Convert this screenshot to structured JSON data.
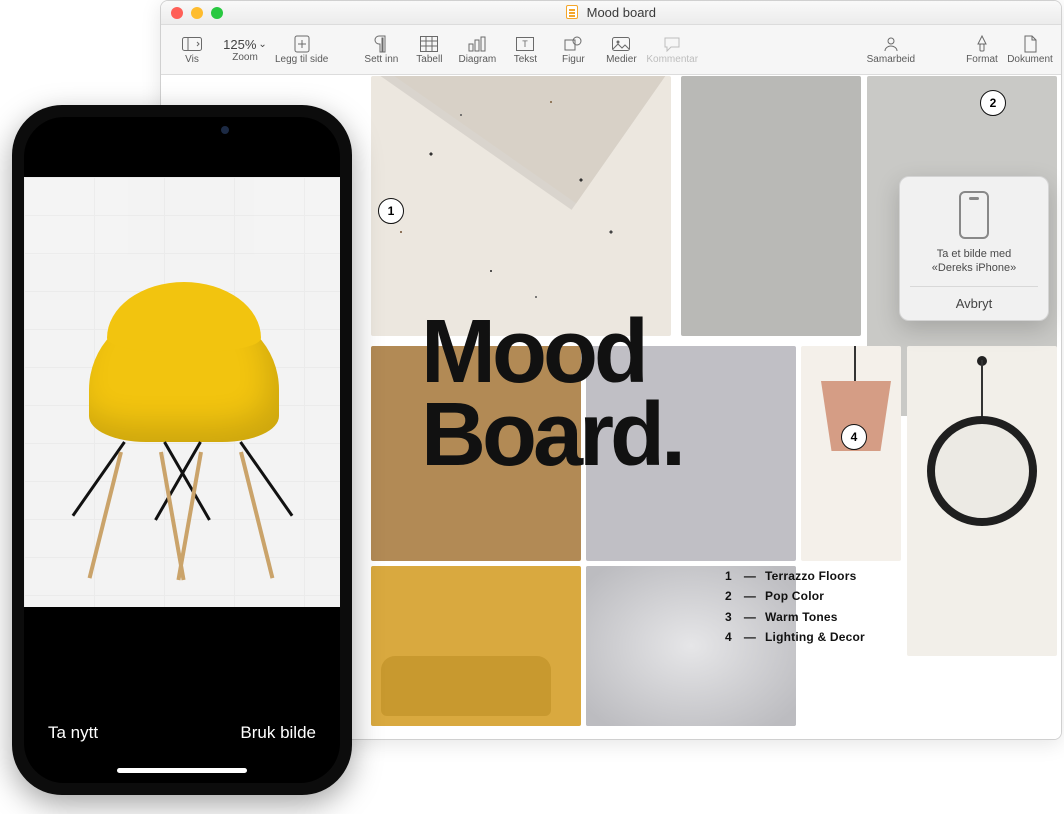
{
  "window": {
    "title": "Mood board"
  },
  "toolbar": {
    "vis": "Vis",
    "zoom_value": "125%",
    "zoom_label": "Zoom",
    "add_page": "Legg til side",
    "insert": "Sett inn",
    "table": "Tabell",
    "chart": "Diagram",
    "text": "Tekst",
    "shape": "Figur",
    "media": "Medier",
    "comment": "Kommentar",
    "collaborate": "Samarbeid",
    "format": "Format",
    "document": "Dokument"
  },
  "moodboard": {
    "title_line1": "Mood",
    "title_line2": "Board.",
    "badges": {
      "b1": "1",
      "b2": "2",
      "b4": "4"
    },
    "legend": [
      {
        "n": "1",
        "label": "Terrazzo Floors"
      },
      {
        "n": "2",
        "label": "Pop Color"
      },
      {
        "n": "3",
        "label": "Warm Tones"
      },
      {
        "n": "4",
        "label": "Lighting & Decor"
      }
    ]
  },
  "popover": {
    "line1": "Ta et bilde med",
    "line2": "«Dereks iPhone»",
    "cancel": "Avbryt"
  },
  "iphone": {
    "retake": "Ta nytt",
    "use": "Bruk bilde"
  }
}
